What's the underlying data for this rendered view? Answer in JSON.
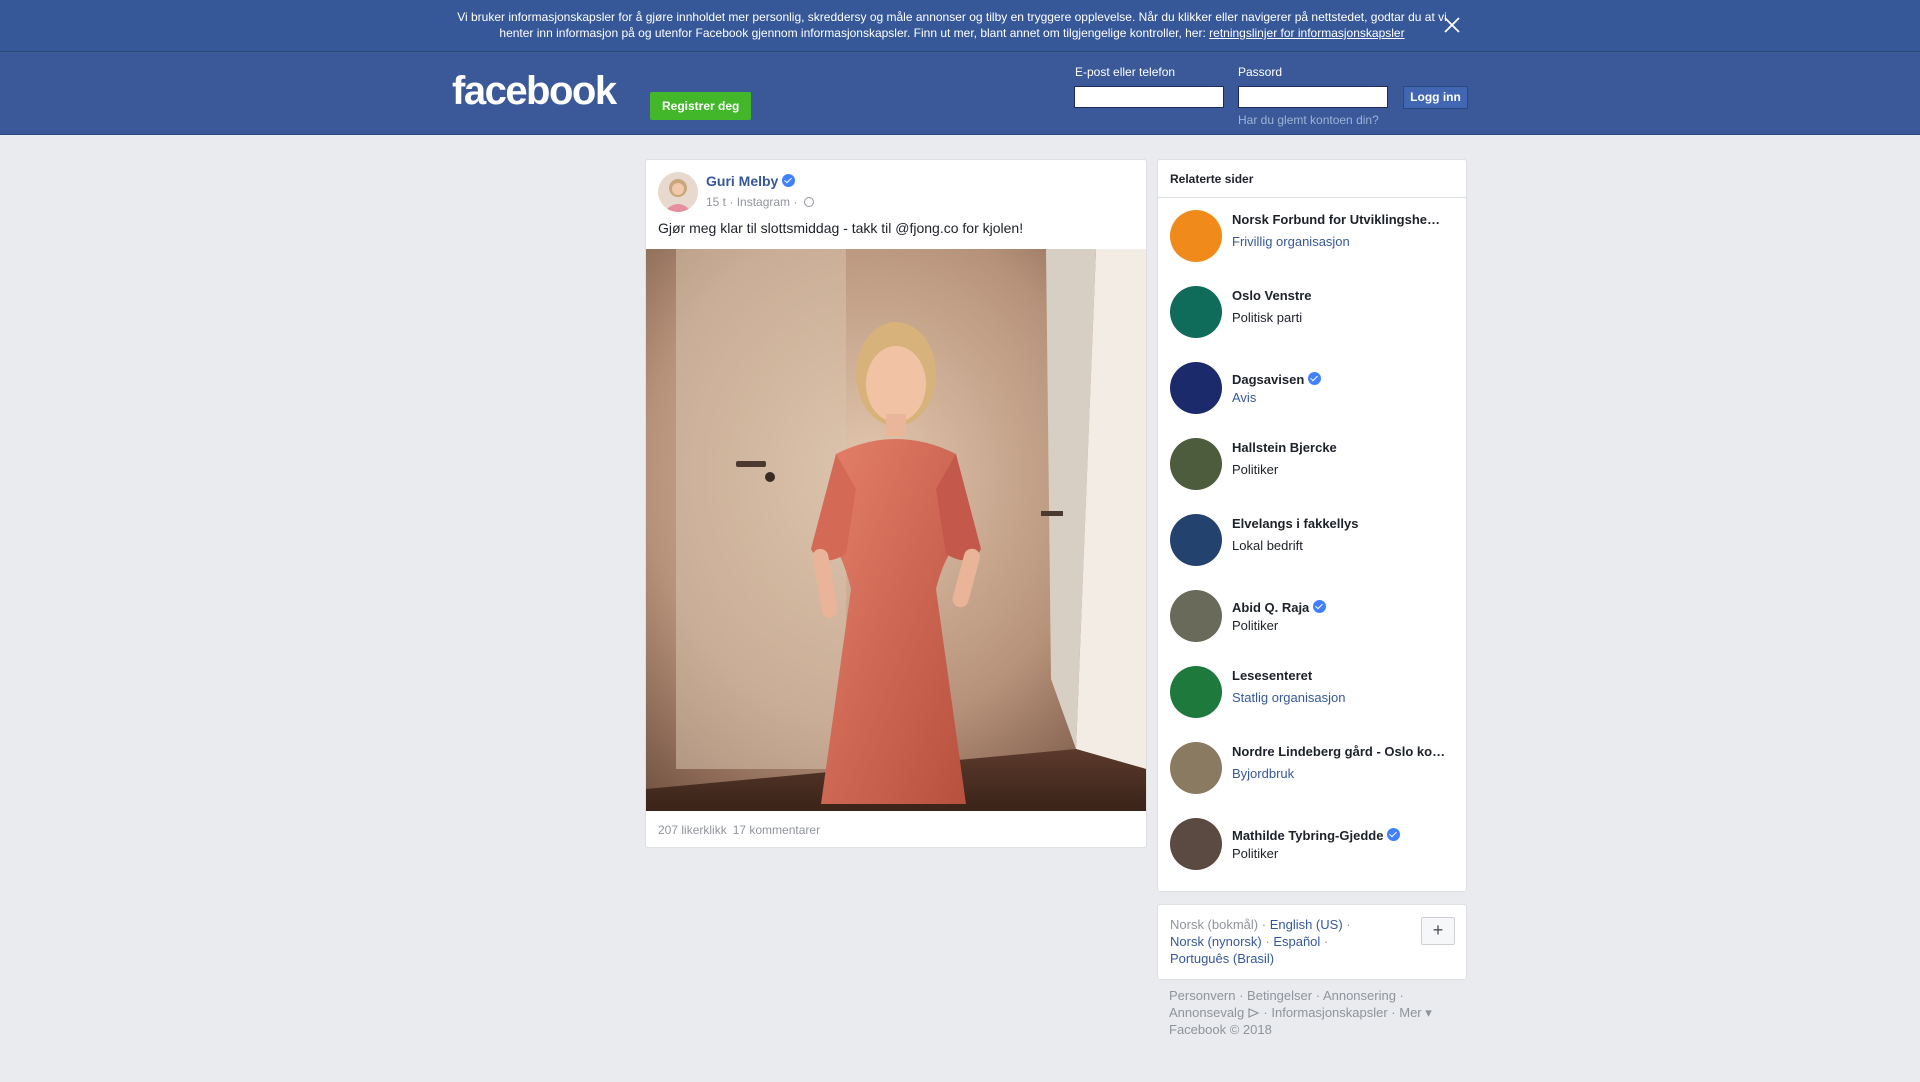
{
  "cookie_banner": {
    "text": "Vi bruker informasjonskapsler for å gjøre innholdet mer personlig, skreddersy og måle annonser og tilby en tryggere opplevelse. Når du klikker eller navigerer på nettstedet, godtar du at vi henter inn informasjon på og utenfor Facebook gjennom informasjonskapsler. Finn ut mer, blant annet om tilgjengelige kontroller, her:",
    "link": "retningslinjer for informasjonskapsler",
    "close_icon": "close-icon"
  },
  "header": {
    "logo": "facebook",
    "register_label": "Registrer deg",
    "email_label": "E-post eller telefon",
    "password_label": "Passord",
    "login_label": "Logg inn",
    "forgot_label": "Har du glemt kontoen din?"
  },
  "post": {
    "author": "Guri Melby",
    "time": "15 t",
    "source": "Instagram",
    "privacy_icon": "globe-icon",
    "text": "Gjør meg klar til slottsmiddag - takk til @fjong.co for kjolen!",
    "likes": "207 likerklikk",
    "comments": "17 kommentarer"
  },
  "related": {
    "title": "Relaterte sider",
    "pages": [
      {
        "name": "Norsk Forbund for Utviklingshe…",
        "category": "Frivillig organisasjon",
        "verified": false,
        "link": true,
        "color": "#f08a1a"
      },
      {
        "name": "Oslo Venstre",
        "category": "Politisk parti",
        "verified": false,
        "link": false,
        "color": "#0f6b5a"
      },
      {
        "name": "Dagsavisen",
        "category": "Avis",
        "verified": true,
        "link": true,
        "color": "#1b2a6b"
      },
      {
        "name": "Hallstein Bjercke",
        "category": "Politiker",
        "verified": false,
        "link": false,
        "color": "#4c5c3c"
      },
      {
        "name": "Elvelangs i fakkellys",
        "category": "Lokal bedrift",
        "verified": false,
        "link": false,
        "color": "#23436e"
      },
      {
        "name": "Abid Q. Raja",
        "category": "Politiker",
        "verified": true,
        "link": false,
        "color": "#6a6a5a"
      },
      {
        "name": "Lesesenteret",
        "category": "Statlig organisasjon",
        "verified": false,
        "link": true,
        "color": "#1e7a3c"
      },
      {
        "name": "Nordre Lindeberg gård - Oslo ko…",
        "category": "Byjordbruk",
        "verified": false,
        "link": true,
        "color": "#8a7a62"
      },
      {
        "name": "Mathilde Tybring-Gjedde",
        "category": "Politiker",
        "verified": true,
        "link": false,
        "color": "#5a4a42"
      }
    ]
  },
  "languages": {
    "current": "Norsk (bokmål)",
    "others": [
      "English (US)",
      "Norsk (nynorsk)",
      "Español",
      "Português (Brasil)"
    ],
    "plus": "+"
  },
  "footer": {
    "links": [
      "Personvern",
      "Betingelser",
      "Annonsering",
      "Annonsevalg",
      "Informasjonskapsler",
      "Mer"
    ],
    "copyright": "Facebook © 2018"
  },
  "colors": {
    "brand": "#3b5998",
    "banner": "#365899",
    "register": "#42b72a",
    "link": "#365899"
  }
}
